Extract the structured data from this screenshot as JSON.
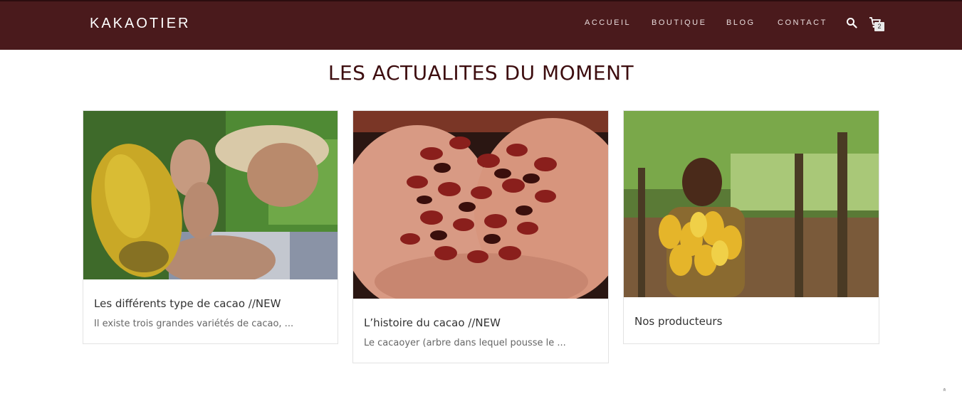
{
  "header": {
    "logo": "KAKAOTIER",
    "nav": [
      "ACCUEIL",
      "BOUTIQUE",
      "BLOG",
      "CONTACT"
    ],
    "cart_count": "2"
  },
  "section": {
    "heading": "LES ACTUALITES DU MOMENT"
  },
  "posts": [
    {
      "title": "Les différents type de cacao //NEW",
      "excerpt": "Il existe trois grandes variétés de cacao, ..."
    },
    {
      "title": "L’histoire du cacao //NEW",
      "excerpt": "Le cacaoyer (arbre dans lequel pousse le ..."
    },
    {
      "title": "Nos producteurs",
      "excerpt": ""
    }
  ],
  "footer": {
    "scroll_top": "»"
  },
  "colors": {
    "header_bg": "#4a1a1c",
    "heading": "#3d0d0f"
  }
}
